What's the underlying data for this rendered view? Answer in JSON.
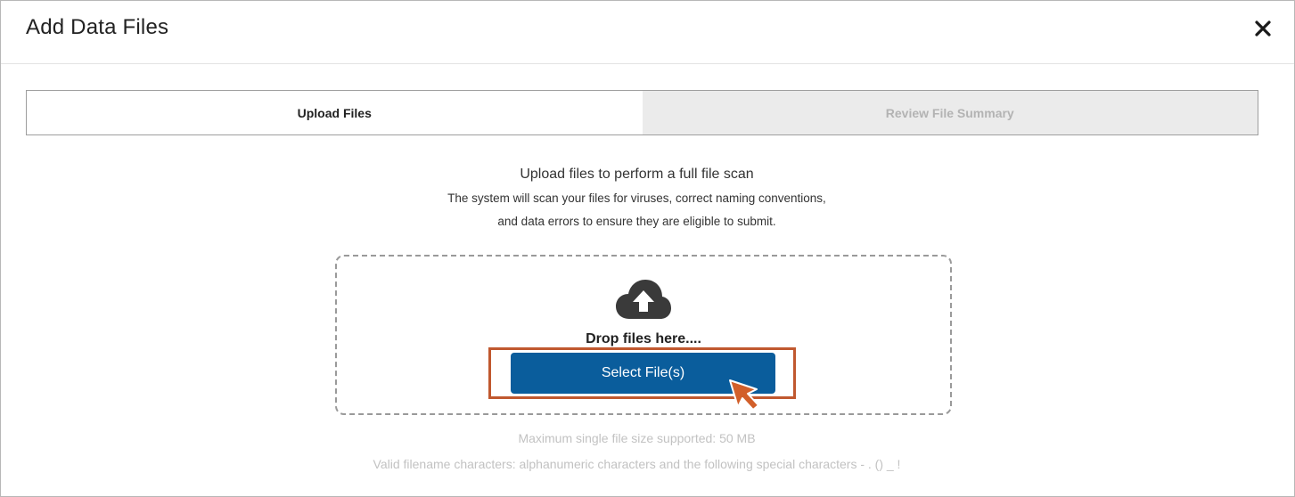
{
  "dialog": {
    "title": "Add Data Files",
    "close_symbol": "✕"
  },
  "steps": [
    {
      "label": "Upload Files",
      "state": "active"
    },
    {
      "label": "Review File Summary",
      "state": "inactive"
    }
  ],
  "intro": {
    "title": "Upload files to perform a full file scan",
    "line1": "The system will scan your files for viruses, correct naming conventions,",
    "line2": "and data errors to ensure they are eligible to submit."
  },
  "dropzone": {
    "icon": "cloud-upload-icon",
    "text": "Drop files here....",
    "button_label": "Select File(s)"
  },
  "info": {
    "max_size": "Maximum single file size supported: 50 MB",
    "valid_chars": "Valid filename characters: alphanumeric characters and the following special characters - . () _ !"
  },
  "colors": {
    "primary_button": "#0a5d9c",
    "highlight": "#c0582f",
    "cursor": "#d25f2a",
    "inactive_step_bg": "#ebebeb",
    "muted_text": "#c2c2c2"
  }
}
